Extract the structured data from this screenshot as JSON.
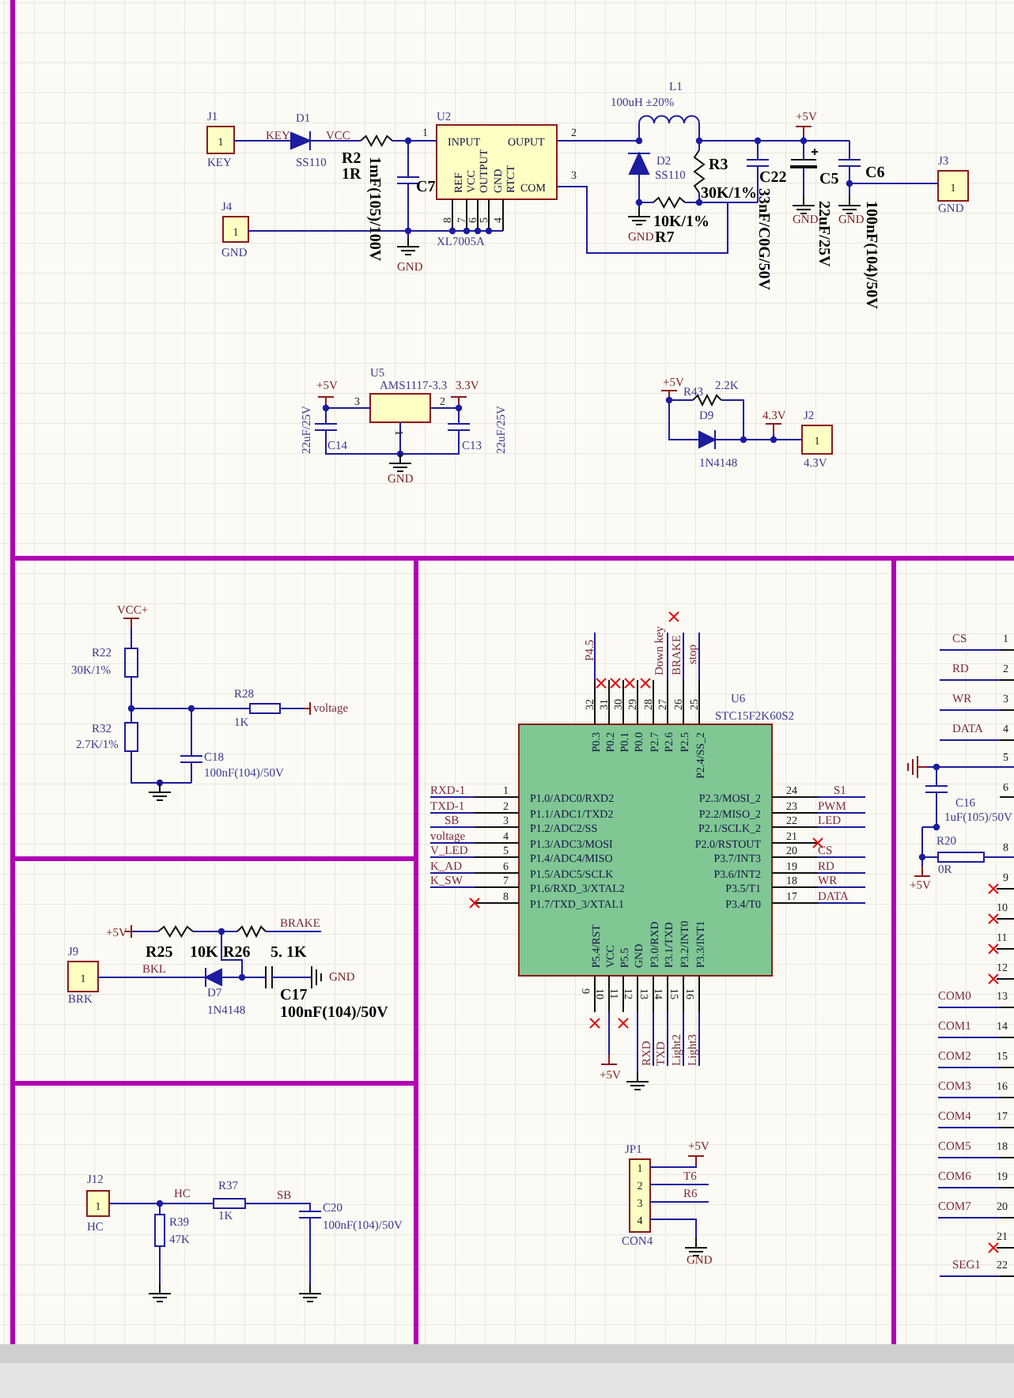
{
  "schematic": {
    "blocks": [
      {
        "kind": "boost_converter",
        "labels": [
          {
            "text": "J1",
            "kind": "ref"
          },
          {
            "text": "1",
            "kind": "pin"
          },
          {
            "text": "KEY",
            "kind": "val"
          },
          {
            "text": "KEY",
            "kind": "net"
          },
          {
            "text": "D1",
            "kind": "ref"
          },
          {
            "text": "SS110",
            "kind": "val"
          },
          {
            "text": "VCC",
            "kind": "net"
          },
          {
            "text": "R2",
            "kind": "refb"
          },
          {
            "text": "1R",
            "kind": "valb"
          },
          {
            "text": "1mF(105)/100V",
            "kind": "valb"
          },
          {
            "text": "C7",
            "kind": "refb"
          },
          {
            "text": "U2",
            "kind": "ref"
          },
          {
            "text": "1",
            "kind": "pin"
          },
          {
            "text": "INPUT",
            "kind": "pinname"
          },
          {
            "text": "OUPUT",
            "kind": "pinname"
          },
          {
            "text": "2",
            "kind": "pin"
          },
          {
            "text": "REF",
            "kind": "pinname"
          },
          {
            "text": "VCC",
            "kind": "pinname"
          },
          {
            "text": "OUTPUT",
            "kind": "pinname"
          },
          {
            "text": "GND",
            "kind": "pinname"
          },
          {
            "text": "RTCT",
            "kind": "pinname"
          },
          {
            "text": "COM",
            "kind": "pinname"
          },
          {
            "text": "3",
            "kind": "pin"
          },
          {
            "text": "8",
            "kind": "pin"
          },
          {
            "text": "7",
            "kind": "pin"
          },
          {
            "text": "6",
            "kind": "pin"
          },
          {
            "text": "5",
            "kind": "pin"
          },
          {
            "text": "4",
            "kind": "pin"
          },
          {
            "text": "XL7005A",
            "kind": "val"
          },
          {
            "text": "J4",
            "kind": "ref"
          },
          {
            "text": "1",
            "kind": "pin"
          },
          {
            "text": "GND",
            "kind": "val"
          },
          {
            "text": "GND",
            "kind": "power"
          },
          {
            "text": "L1",
            "kind": "ref"
          },
          {
            "text": "100uH ±20%",
            "kind": "val"
          },
          {
            "text": "D2",
            "kind": "ref"
          },
          {
            "text": "SS110",
            "kind": "val"
          },
          {
            "text": "R3",
            "kind": "refb"
          },
          {
            "text": "30K/1%",
            "kind": "valb"
          },
          {
            "text": "C22",
            "kind": "refb"
          },
          {
            "text": "33nF/C0G/50V",
            "kind": "valb"
          },
          {
            "text": "+5V",
            "kind": "power"
          },
          {
            "text": "C5",
            "kind": "refb"
          },
          {
            "text": "22uF/25V",
            "kind": "valb"
          },
          {
            "text": "C6",
            "kind": "refb"
          },
          {
            "text": "100nF(104)/50V",
            "kind": "valb"
          },
          {
            "text": "GND",
            "kind": "power"
          },
          {
            "text": "10K/1%",
            "kind": "valb"
          },
          {
            "text": "R7",
            "kind": "refb"
          },
          {
            "text": "GND",
            "kind": "power"
          },
          {
            "text": "GND",
            "kind": "power"
          },
          {
            "text": "J3",
            "kind": "ref"
          },
          {
            "text": "1",
            "kind": "pin"
          },
          {
            "text": "GND",
            "kind": "val"
          }
        ]
      },
      {
        "kind": "ldo_regulator",
        "labels": [
          {
            "text": "U5",
            "kind": "ref"
          },
          {
            "text": "+5V",
            "kind": "power"
          },
          {
            "text": "AMS1117-3.3",
            "kind": "val"
          },
          {
            "text": "3.3V",
            "kind": "power"
          },
          {
            "text": "3",
            "kind": "pin"
          },
          {
            "text": "2",
            "kind": "pin"
          },
          {
            "text": "1",
            "kind": "pin"
          },
          {
            "text": "22uF/25V",
            "kind": "val"
          },
          {
            "text": "C14",
            "kind": "ref"
          },
          {
            "text": "C13",
            "kind": "ref"
          },
          {
            "text": "22uF/25V",
            "kind": "val"
          },
          {
            "text": "GND",
            "kind": "power"
          }
        ]
      },
      {
        "kind": "reference_diode",
        "labels": [
          {
            "text": "+5V",
            "kind": "power"
          },
          {
            "text": "R43",
            "kind": "ref"
          },
          {
            "text": "2.2K",
            "kind": "val"
          },
          {
            "text": "D9",
            "kind": "ref"
          },
          {
            "text": "1N4148",
            "kind": "val"
          },
          {
            "text": "4.3V",
            "kind": "power"
          },
          {
            "text": "J2",
            "kind": "ref"
          },
          {
            "text": "1",
            "kind": "pin"
          },
          {
            "text": "4.3V",
            "kind": "val"
          }
        ]
      },
      {
        "kind": "voltage_divider",
        "labels": [
          {
            "text": "VCC+",
            "kind": "power"
          },
          {
            "text": "R22",
            "kind": "ref"
          },
          {
            "text": "30K/1%",
            "kind": "val"
          },
          {
            "text": "R28",
            "kind": "ref"
          },
          {
            "text": "1K",
            "kind": "val"
          },
          {
            "text": "voltage",
            "kind": "net"
          },
          {
            "text": "R32",
            "kind": "ref"
          },
          {
            "text": "2.7K/1%",
            "kind": "val"
          },
          {
            "text": "C18",
            "kind": "ref"
          },
          {
            "text": "100nF(104)/50V",
            "kind": "val"
          }
        ]
      },
      {
        "kind": "brake_input",
        "labels": [
          {
            "text": "+5V",
            "kind": "power"
          },
          {
            "text": "R25",
            "kind": "refb"
          },
          {
            "text": "10K",
            "kind": "valb"
          },
          {
            "text": "R26",
            "kind": "refb"
          },
          {
            "text": "5. 1K",
            "kind": "valb"
          },
          {
            "text": "BRAKE",
            "kind": "net"
          },
          {
            "text": "J9",
            "kind": "ref"
          },
          {
            "text": "1",
            "kind": "pin"
          },
          {
            "text": "BRK",
            "kind": "val"
          },
          {
            "text": "BKL",
            "kind": "net"
          },
          {
            "text": "GND",
            "kind": "power"
          },
          {
            "text": "D7",
            "kind": "ref"
          },
          {
            "text": "1N4148",
            "kind": "val"
          },
          {
            "text": "C17",
            "kind": "refb"
          },
          {
            "text": "100nF(104)/50V",
            "kind": "valb"
          }
        ]
      },
      {
        "kind": "hc_input",
        "labels": [
          {
            "text": "J12",
            "kind": "ref"
          },
          {
            "text": "1",
            "kind": "pin"
          },
          {
            "text": "HC",
            "kind": "val"
          },
          {
            "text": "HC",
            "kind": "net"
          },
          {
            "text": "R37",
            "kind": "ref"
          },
          {
            "text": "1K",
            "kind": "val"
          },
          {
            "text": "SB",
            "kind": "net"
          },
          {
            "text": "R39",
            "kind": "ref"
          },
          {
            "text": "47K",
            "kind": "val"
          },
          {
            "text": "C20",
            "kind": "ref"
          },
          {
            "text": "100nF(104)/50V",
            "kind": "val"
          }
        ]
      },
      {
        "kind": "mcu",
        "labels": [
          {
            "text": "U6",
            "kind": "ref"
          },
          {
            "text": "STC15F2K60S2",
            "kind": "val"
          },
          {
            "text": "P4.5",
            "kind": "net"
          },
          {
            "text": "Down key",
            "kind": "net"
          },
          {
            "text": "BRAKE",
            "kind": "net"
          },
          {
            "text": "stop",
            "kind": "net"
          },
          {
            "text": "32",
            "kind": "pin"
          },
          {
            "text": "31",
            "kind": "pin"
          },
          {
            "text": "30",
            "kind": "pin"
          },
          {
            "text": "29",
            "kind": "pin"
          },
          {
            "text": "28",
            "kind": "pin"
          },
          {
            "text": "27",
            "kind": "pin"
          },
          {
            "text": "26",
            "kind": "pin"
          },
          {
            "text": "25",
            "kind": "pin"
          },
          {
            "text": "P0.3",
            "kind": "pinname"
          },
          {
            "text": "P0.2",
            "kind": "pinname"
          },
          {
            "text": "P0.1",
            "kind": "pinname"
          },
          {
            "text": "P0.0",
            "kind": "pinname"
          },
          {
            "text": "P2.7",
            "kind": "pinname"
          },
          {
            "text": "P2.6",
            "kind": "pinname"
          },
          {
            "text": "P2.5",
            "kind": "pinname"
          },
          {
            "text": "P2.4/SS_2",
            "kind": "pinname"
          },
          {
            "text": "RXD-1",
            "kind": "net"
          },
          {
            "text": "TXD-1",
            "kind": "net"
          },
          {
            "text": "SB",
            "kind": "net"
          },
          {
            "text": "voltage",
            "kind": "net"
          },
          {
            "text": "V_LED",
            "kind": "net"
          },
          {
            "text": "K_AD",
            "kind": "net"
          },
          {
            "text": "K_SW",
            "kind": "net"
          },
          {
            "text": "1",
            "kind": "pin"
          },
          {
            "text": "2",
            "kind": "pin"
          },
          {
            "text": "3",
            "kind": "pin"
          },
          {
            "text": "4",
            "kind": "pin"
          },
          {
            "text": "5",
            "kind": "pin"
          },
          {
            "text": "6",
            "kind": "pin"
          },
          {
            "text": "7",
            "kind": "pin"
          },
          {
            "text": "8",
            "kind": "pin"
          },
          {
            "text": "P1.0/ADC0/RXD2",
            "kind": "pinname"
          },
          {
            "text": "P1.1/ADC1/TXD2",
            "kind": "pinname"
          },
          {
            "text": "P1.2/ADC2/SS",
            "kind": "pinname"
          },
          {
            "text": "P1.3/ADC3/MOSI",
            "kind": "pinname"
          },
          {
            "text": "P1.4/ADC4/MISO",
            "kind": "pinname"
          },
          {
            "text": "P1.5/ADC5/SCLK",
            "kind": "pinname"
          },
          {
            "text": "P1.6/RXD_3/XTAL2",
            "kind": "pinname"
          },
          {
            "text": "P1.7/TXD_3/XTAL1",
            "kind": "pinname"
          },
          {
            "text": "P2.3/MOSI_2",
            "kind": "pinname"
          },
          {
            "text": "P2.2/MISO_2",
            "kind": "pinname"
          },
          {
            "text": "P2.1/SCLK_2",
            "kind": "pinname"
          },
          {
            "text": "P2.0/RSTOUT",
            "kind": "pinname"
          },
          {
            "text": "P3.7/INT3",
            "kind": "pinname"
          },
          {
            "text": "P3.6/INT2",
            "kind": "pinname"
          },
          {
            "text": "P3.5/T1",
            "kind": "pinname"
          },
          {
            "text": "P3.4/T0",
            "kind": "pinname"
          },
          {
            "text": "24",
            "kind": "pin"
          },
          {
            "text": "23",
            "kind": "pin"
          },
          {
            "text": "22",
            "kind": "pin"
          },
          {
            "text": "21",
            "kind": "pin"
          },
          {
            "text": "20",
            "kind": "pin"
          },
          {
            "text": "19",
            "kind": "pin"
          },
          {
            "text": "18",
            "kind": "pin"
          },
          {
            "text": "17",
            "kind": "pin"
          },
          {
            "text": "S1",
            "kind": "net"
          },
          {
            "text": "PWM",
            "kind": "net"
          },
          {
            "text": "LED",
            "kind": "net"
          },
          {
            "text": "CS",
            "kind": "net"
          },
          {
            "text": "RD",
            "kind": "net"
          },
          {
            "text": "WR",
            "kind": "net"
          },
          {
            "text": "DATA",
            "kind": "net"
          },
          {
            "text": "9",
            "kind": "pin"
          },
          {
            "text": "10",
            "kind": "pin"
          },
          {
            "text": "11",
            "kind": "pin"
          },
          {
            "text": "12",
            "kind": "pin"
          },
          {
            "text": "13",
            "kind": "pin"
          },
          {
            "text": "14",
            "kind": "pin"
          },
          {
            "text": "15",
            "kind": "pin"
          },
          {
            "text": "16",
            "kind": "pin"
          },
          {
            "text": "P5.4/RST",
            "kind": "pinname"
          },
          {
            "text": "VCC",
            "kind": "pinname"
          },
          {
            "text": "P5.5",
            "kind": "pinname"
          },
          {
            "text": "GND",
            "kind": "pinname"
          },
          {
            "text": "P3.0/RXD",
            "kind": "pinname"
          },
          {
            "text": "P3.1/TXD",
            "kind": "pinname"
          },
          {
            "text": "P3.2/INT0",
            "kind": "pinname"
          },
          {
            "text": "P3.3/INT1",
            "kind": "pinname"
          },
          {
            "text": "RXD",
            "kind": "net"
          },
          {
            "text": "TXD",
            "kind": "net"
          },
          {
            "text": "Light2",
            "kind": "net"
          },
          {
            "text": "Light3",
            "kind": "net"
          },
          {
            "text": "+5V",
            "kind": "power"
          }
        ]
      },
      {
        "kind": "header",
        "labels": [
          {
            "text": "JP1",
            "kind": "ref"
          },
          {
            "text": "+5V",
            "kind": "power"
          },
          {
            "text": "1",
            "kind": "pin"
          },
          {
            "text": "2",
            "kind": "pin"
          },
          {
            "text": "3",
            "kind": "pin"
          },
          {
            "text": "4",
            "kind": "pin"
          },
          {
            "text": "T6",
            "kind": "net"
          },
          {
            "text": "R6",
            "kind": "net"
          },
          {
            "text": "CON4",
            "kind": "val"
          },
          {
            "text": "GND",
            "kind": "power"
          }
        ]
      },
      {
        "kind": "lcd_connector",
        "labels": [
          {
            "text": "CS",
            "kind": "net"
          },
          {
            "text": "1",
            "kind": "pin"
          },
          {
            "text": "RD",
            "kind": "net"
          },
          {
            "text": "2",
            "kind": "pin"
          },
          {
            "text": "WR",
            "kind": "net"
          },
          {
            "text": "3",
            "kind": "pin"
          },
          {
            "text": "DATA",
            "kind": "net"
          },
          {
            "text": "4",
            "kind": "pin"
          },
          {
            "text": "5",
            "kind": "pin"
          },
          {
            "text": "6",
            "kind": "pin"
          },
          {
            "text": "C16",
            "kind": "ref"
          },
          {
            "text": "1uF(105)/50V",
            "kind": "val"
          },
          {
            "text": "R20",
            "kind": "ref"
          },
          {
            "text": "0R",
            "kind": "val"
          },
          {
            "text": "+5V",
            "kind": "power"
          },
          {
            "text": "8",
            "kind": "pin"
          },
          {
            "text": "9",
            "kind": "pin"
          },
          {
            "text": "10",
            "kind": "pin"
          },
          {
            "text": "11",
            "kind": "pin"
          },
          {
            "text": "12",
            "kind": "pin"
          },
          {
            "text": "COM0",
            "kind": "net"
          },
          {
            "text": "13",
            "kind": "pin"
          },
          {
            "text": "COM1",
            "kind": "net"
          },
          {
            "text": "14",
            "kind": "pin"
          },
          {
            "text": "COM2",
            "kind": "net"
          },
          {
            "text": "15",
            "kind": "pin"
          },
          {
            "text": "COM3",
            "kind": "net"
          },
          {
            "text": "16",
            "kind": "pin"
          },
          {
            "text": "COM4",
            "kind": "net"
          },
          {
            "text": "17",
            "kind": "pin"
          },
          {
            "text": "COM5",
            "kind": "net"
          },
          {
            "text": "18",
            "kind": "pin"
          },
          {
            "text": "COM6",
            "kind": "net"
          },
          {
            "text": "19",
            "kind": "pin"
          },
          {
            "text": "COM7",
            "kind": "net"
          },
          {
            "text": "20",
            "kind": "pin"
          },
          {
            "text": "21",
            "kind": "pin"
          },
          {
            "text": "SEG1",
            "kind": "net"
          },
          {
            "text": "22",
            "kind": "pin"
          }
        ]
      }
    ]
  }
}
